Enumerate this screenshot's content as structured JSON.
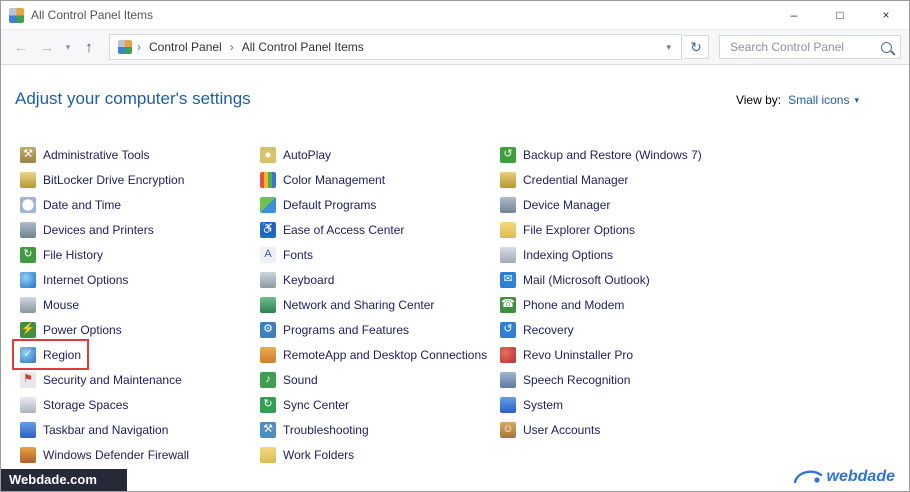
{
  "window": {
    "title": "All Control Panel Items",
    "controls": {
      "minimize": "–",
      "maximize": "□",
      "close": "×"
    }
  },
  "navbar": {
    "back_icon": "←",
    "forward_icon": "→",
    "recent_caret": "▾",
    "up_icon": "↑",
    "breadcrumb": {
      "separator": "›",
      "items": [
        "Control Panel",
        "All Control Panel Items"
      ],
      "dropdown_caret": "▾",
      "refresh_icon": "↻"
    },
    "search": {
      "placeholder": "Search Control Panel"
    }
  },
  "header": {
    "title": "Adjust your computer's settings",
    "view_by_label": "View by:",
    "view_by_value": "Small icons",
    "view_by_caret": "▾"
  },
  "columns": [
    [
      {
        "label": "Administrative Tools",
        "icon": "admin-tools-icon",
        "glyph": "⚒",
        "fg": "#ffffff",
        "bg": "linear-gradient(180deg,#c2ab6a,#9a8445)"
      },
      {
        "label": "BitLocker Drive Encryption",
        "icon": "bitlocker-icon",
        "glyph": "",
        "bg": "linear-gradient(180deg,#e8d48a,#b8962e)"
      },
      {
        "label": "Date and Time",
        "icon": "date-time-icon",
        "glyph": "",
        "bg": "radial-gradient(circle,#ffffff 48%,#9fb4d8 52%)"
      },
      {
        "label": "Devices and Printers",
        "icon": "devices-printers-icon",
        "glyph": "",
        "bg": "linear-gradient(180deg,#aebdc9,#6f8494)"
      },
      {
        "label": "File History",
        "icon": "file-history-icon",
        "glyph": "↻",
        "fg": "#ffffff",
        "bg": "#3f9b3f"
      },
      {
        "label": "Internet Options",
        "icon": "internet-options-icon",
        "glyph": "",
        "bg": "radial-gradient(circle at 35% 35%,#8fd0f5,#1f6fc4)"
      },
      {
        "label": "Mouse",
        "icon": "mouse-icon",
        "glyph": "",
        "bg": "linear-gradient(180deg,#cfd6dd,#8a97a3)"
      },
      {
        "label": "Power Options",
        "icon": "power-options-icon",
        "glyph": "⚡",
        "fg": "#ffffff",
        "bg": "#3f8f3f"
      },
      {
        "label": "Region",
        "icon": "region-icon",
        "glyph": "✓",
        "fg": "#d6ffd6",
        "bg": "radial-gradient(circle at 35% 35%,#8fd0f5,#2f6fc4)",
        "highlight": true
      },
      {
        "label": "Security and Maintenance",
        "icon": "security-maintenance-icon",
        "glyph": "⚑",
        "fg": "#d23f2f",
        "bg": "#e8e8ec"
      },
      {
        "label": "Storage Spaces",
        "icon": "storage-spaces-icon",
        "glyph": "",
        "bg": "linear-gradient(180deg,#e8ecf0,#aab4be)"
      },
      {
        "label": "Taskbar and Navigation",
        "icon": "taskbar-icon",
        "glyph": "",
        "bg": "linear-gradient(180deg,#5f9fe8,#2f5fc0)"
      },
      {
        "label": "Windows Defender Firewall",
        "icon": "firewall-icon",
        "glyph": "",
        "bg": "linear-gradient(180deg,#e8a23f,#b05f2f)"
      }
    ],
    [
      {
        "label": "AutoPlay",
        "icon": "autoplay-icon",
        "glyph": "",
        "bg": "radial-gradient(circle,#ffffff 18%,#d9c26a 26%)"
      },
      {
        "label": "Color Management",
        "icon": "color-management-icon",
        "glyph": "",
        "bg": "linear-gradient(90deg,#e5533d 0 25%,#f2b632 25% 50%,#4caf50 50% 75%,#3f6fd8 75% 100%)"
      },
      {
        "label": "Default Programs",
        "icon": "default-programs-icon",
        "glyph": "",
        "bg": "linear-gradient(135deg,#6fc24f 50%,#3f8fd8 50%)"
      },
      {
        "label": "Ease of Access Center",
        "icon": "ease-of-access-icon",
        "glyph": "♿",
        "fg": "#ffffff",
        "bg": "#1f6fc0"
      },
      {
        "label": "Fonts",
        "icon": "fonts-icon",
        "glyph": "A",
        "fg": "#3f5fa0",
        "bg": "#eef0f5"
      },
      {
        "label": "Keyboard",
        "icon": "keyboard-icon",
        "glyph": "",
        "bg": "linear-gradient(180deg,#cdd5dc,#8d99a5)"
      },
      {
        "label": "Network and Sharing Center",
        "icon": "network-sharing-icon",
        "glyph": "",
        "bg": "linear-gradient(180deg,#6fbf8f,#2f7f4f)"
      },
      {
        "label": "Programs and Features",
        "icon": "programs-features-icon",
        "glyph": "⚙",
        "fg": "#ffffff",
        "bg": "#3f7fbf"
      },
      {
        "label": "RemoteApp and Desktop Connections",
        "icon": "remoteapp-icon",
        "glyph": "",
        "bg": "linear-gradient(180deg,#f0a84f,#d07f2f)"
      },
      {
        "label": "Sound",
        "icon": "sound-icon",
        "glyph": "♪",
        "fg": "#ffffff",
        "bg": "#3f9f4f"
      },
      {
        "label": "Sync Center",
        "icon": "sync-center-icon",
        "glyph": "↻",
        "fg": "#ffffff",
        "bg": "#2fa04f"
      },
      {
        "label": "Troubleshooting",
        "icon": "troubleshooting-icon",
        "glyph": "⚒",
        "fg": "#ffffff",
        "bg": "#4f8fbf"
      },
      {
        "label": "Work Folders",
        "icon": "work-folders-icon",
        "glyph": "",
        "bg": "linear-gradient(180deg,#f5d97f,#e0b84f)"
      }
    ],
    [
      {
        "label": "Backup and Restore (Windows 7)",
        "icon": "backup-restore-icon",
        "glyph": "↺",
        "fg": "#ffffff",
        "bg": "#3f9f3f"
      },
      {
        "label": "Credential Manager",
        "icon": "credential-manager-icon",
        "glyph": "",
        "bg": "linear-gradient(180deg,#e8cf7f,#b8962e)"
      },
      {
        "label": "Device Manager",
        "icon": "device-manager-icon",
        "glyph": "",
        "bg": "linear-gradient(180deg,#aebdc9,#6f8494)"
      },
      {
        "label": "File Explorer Options",
        "icon": "file-explorer-options-icon",
        "glyph": "",
        "bg": "linear-gradient(180deg,#f5d97f,#e0b84f)"
      },
      {
        "label": "Indexing Options",
        "icon": "indexing-options-icon",
        "glyph": "",
        "bg": "linear-gradient(180deg,#d5dde5,#9fa9b5)"
      },
      {
        "label": "Mail (Microsoft Outlook)",
        "icon": "mail-icon",
        "glyph": "✉",
        "fg": "#ffffff",
        "bg": "#2f7fd4"
      },
      {
        "label": "Phone and Modem",
        "icon": "phone-modem-icon",
        "glyph": "☎",
        "fg": "#ffffff",
        "bg": "#3f8f3f"
      },
      {
        "label": "Recovery",
        "icon": "recovery-icon",
        "glyph": "↺",
        "fg": "#ffffff",
        "bg": "#2f7fd4"
      },
      {
        "label": "Revo Uninstaller Pro",
        "icon": "revo-uninstaller-icon",
        "glyph": "",
        "bg": "radial-gradient(circle at 35% 35%,#e86f5f,#b03030)"
      },
      {
        "label": "Speech Recognition",
        "icon": "speech-recognition-icon",
        "glyph": "",
        "bg": "linear-gradient(180deg,#9fb4cf,#5f7a9f)"
      },
      {
        "label": "System",
        "icon": "system-icon",
        "glyph": "",
        "bg": "linear-gradient(180deg,#5f9fe8,#2f5fc0)"
      },
      {
        "label": "User Accounts",
        "icon": "user-accounts-icon",
        "glyph": "☺",
        "fg": "#ffffff",
        "bg": "linear-gradient(180deg,#d8a95f,#a8743f)"
      }
    ]
  ],
  "footer": {
    "watermark": "Webdade.com",
    "logo_text": "webdade",
    "logo_color": "#2f72d9"
  }
}
